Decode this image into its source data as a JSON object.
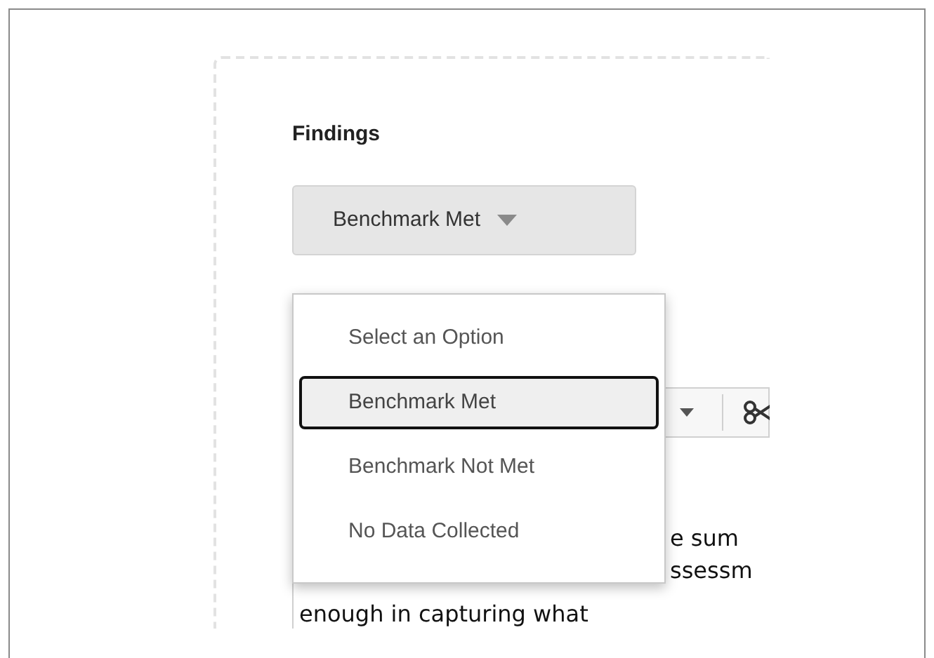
{
  "field": {
    "label": "Findings",
    "value": "Benchmark Met"
  },
  "dropdown": {
    "options": [
      {
        "label": "Select an Option",
        "selected": false
      },
      {
        "label": "Benchmark Met",
        "selected": true
      },
      {
        "label": "Benchmark Not Met",
        "selected": false
      },
      {
        "label": "No Data Collected",
        "selected": false
      }
    ]
  },
  "editor": {
    "text_lines": [
      "e sum",
      "ssessm",
      "enough in capturing what"
    ]
  }
}
